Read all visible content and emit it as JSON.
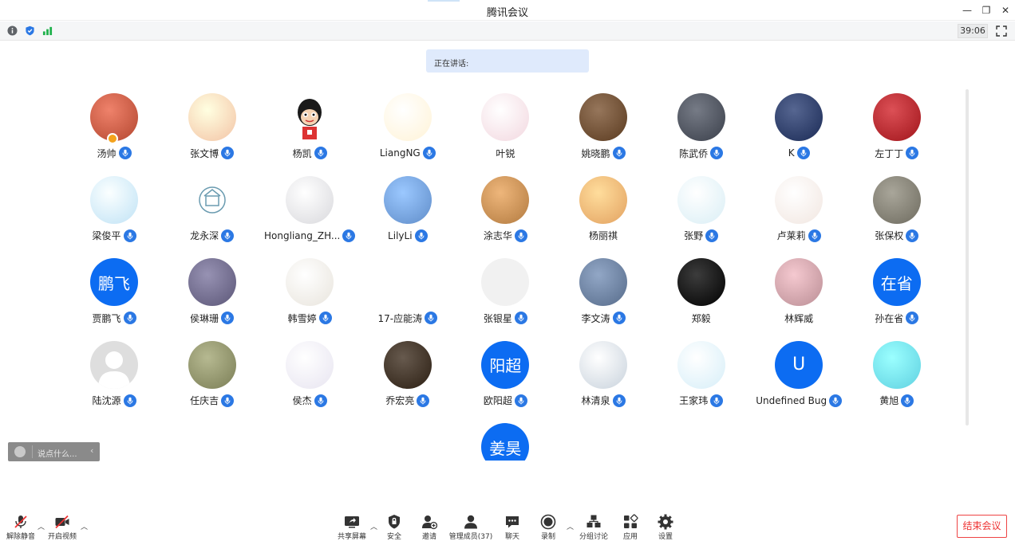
{
  "window": {
    "title": "腾讯会议"
  },
  "infobar": {
    "timer": "39:06"
  },
  "speaking": {
    "label": "正在讲话:"
  },
  "participants": [
    {
      "name": "汤帅",
      "avatar": "photo",
      "color": "#b3462f",
      "host": true
    },
    {
      "name": "张文博",
      "avatar": "photo",
      "color": "#f3c3a5"
    },
    {
      "name": "杨凯",
      "avatar": "cartoon",
      "color": "#ffffff"
    },
    {
      "name": "LiangNG",
      "avatar": "photo",
      "color": "#fff3d6"
    },
    {
      "name": "叶锐",
      "avatar": "photo",
      "color": "#f2d7df",
      "muted": false
    },
    {
      "name": "姚晓鹏",
      "avatar": "photo",
      "color": "#5a3a1f"
    },
    {
      "name": "陈武侨",
      "avatar": "photo",
      "color": "#3a3f4a"
    },
    {
      "name": "K",
      "avatar": "photo",
      "color": "#1a2a55"
    },
    {
      "name": "左丁丁",
      "avatar": "photo",
      "color": "#a0141a"
    },
    {
      "name": "梁俊平",
      "avatar": "photo",
      "color": "#bfe2f5"
    },
    {
      "name": "龙永深",
      "avatar": "logo",
      "color": "#ffffff"
    },
    {
      "name": "Hongliang_ZH...",
      "avatar": "photo",
      "color": "#d8d8dc"
    },
    {
      "name": "LilyLi",
      "avatar": "photo",
      "color": "#5f8cc8"
    },
    {
      "name": "涂志华",
      "avatar": "photo",
      "color": "#b27a3f"
    },
    {
      "name": "杨丽祺",
      "avatar": "photo",
      "color": "#e2a160",
      "muted": false
    },
    {
      "name": "张野",
      "avatar": "photo",
      "color": "#d9eef5"
    },
    {
      "name": "卢莱莉",
      "avatar": "photo",
      "color": "#f1e6e0"
    },
    {
      "name": "张保权",
      "avatar": "photo",
      "color": "#6d6a5e"
    },
    {
      "name": "贾鹏飞",
      "avatar": "text",
      "text": "鹏飞"
    },
    {
      "name": "侯琳珊",
      "avatar": "photo",
      "color": "#5b5677"
    },
    {
      "name": "韩雪婷",
      "avatar": "photo",
      "color": "#e8e4dc"
    },
    {
      "name": "17-应能涛",
      "avatar": "photo",
      "color": "#ffffff"
    },
    {
      "name": "张银星",
      "avatar": "blank",
      "color": "#f1f1f1"
    },
    {
      "name": "李文涛",
      "avatar": "photo",
      "color": "#566b8a"
    },
    {
      "name": "郑毅",
      "avatar": "photo",
      "color": "#000000",
      "muted": false
    },
    {
      "name": "林辉威",
      "avatar": "photo",
      "color": "#b98d94",
      "muted": false
    },
    {
      "name": "孙在省",
      "avatar": "text",
      "text": "在省"
    },
    {
      "name": "陆沈源",
      "avatar": "default",
      "color": "#dedede"
    },
    {
      "name": "任庆吉",
      "avatar": "photo",
      "color": "#7a7d55"
    },
    {
      "name": "侯杰",
      "avatar": "photo",
      "color": "#e7e4f0"
    },
    {
      "name": "乔宏亮",
      "avatar": "photo",
      "color": "#2b1e12"
    },
    {
      "name": "欧阳超",
      "avatar": "text",
      "text": "阳超"
    },
    {
      "name": "林清泉",
      "avatar": "photo",
      "color": "#c8d2dc"
    },
    {
      "name": "王家玮",
      "avatar": "photo",
      "color": "#d6eef8"
    },
    {
      "name": "Undefined Bug",
      "avatar": "text",
      "text": "U"
    },
    {
      "name": "黄旭",
      "avatar": "photo",
      "color": "#5fd0e0"
    },
    {
      "name": "",
      "avatar": "text",
      "text": "姜昊"
    }
  ],
  "chat": {
    "placeholder": "说点什么..."
  },
  "toolbar": {
    "unmute": "解除静音",
    "video": "开启视频",
    "share": "共享屏幕",
    "security": "安全",
    "invite": "邀请",
    "members": "管理成员(37)",
    "chat": "聊天",
    "record": "录制",
    "breakout": "分组讨论",
    "apps": "应用",
    "settings": "设置",
    "end": "结束会议"
  },
  "colors": {
    "accent": "#0c6cf2",
    "mic": "#2b78e4",
    "end": "#e33333"
  }
}
